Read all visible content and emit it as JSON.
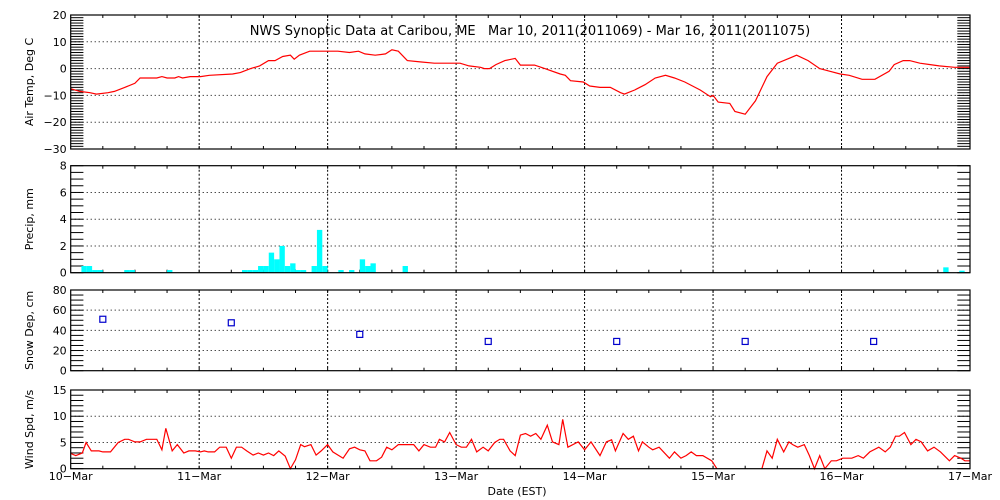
{
  "chart_data": {
    "title": "NWS Synoptic Data at Caribou, ME   Mar 10, 2011(2011069) - Mar 16, 2011(2011075)",
    "xlabel": "Date (EST)",
    "x_units": "days since 10-Mar 00:00 EST",
    "xlim": [
      0,
      7
    ],
    "x_tick_labels": [
      "10-Mar",
      "11-Mar",
      "12-Mar",
      "13-Mar",
      "14-Mar",
      "15-Mar",
      "16-Mar",
      "17-Mar"
    ],
    "grid": true,
    "colors": {
      "temp": "#ff0000",
      "precip": "#00ffff",
      "snow": "#0000cc",
      "wind": "#ff0000"
    },
    "panels": [
      {
        "id": "air-temp",
        "type": "line",
        "ylabel": "Air Temp, Deg C",
        "ylim": [
          -30,
          20
        ],
        "yticks": [
          -30,
          -20,
          -10,
          0,
          10,
          20
        ],
        "minor_step": 1,
        "points": [
          [
            0,
            -7.5
          ],
          [
            0.07,
            -8.5
          ],
          [
            0.15,
            -9
          ],
          [
            0.2,
            -9.5
          ],
          [
            0.29,
            -9
          ],
          [
            0.34,
            -8.5
          ],
          [
            0.42,
            -7
          ],
          [
            0.5,
            -5.5
          ],
          [
            0.54,
            -3.5
          ],
          [
            0.67,
            -3.5
          ],
          [
            0.71,
            -3
          ],
          [
            0.75,
            -3.5
          ],
          [
            0.81,
            -3.5
          ],
          [
            0.84,
            -3
          ],
          [
            0.87,
            -3.5
          ],
          [
            0.93,
            -3
          ],
          [
            1.01,
            -3
          ],
          [
            1.08,
            -2.5
          ],
          [
            1.26,
            -2
          ],
          [
            1.32,
            -1.5
          ],
          [
            1.4,
            0
          ],
          [
            1.47,
            1
          ],
          [
            1.54,
            3
          ],
          [
            1.59,
            3
          ],
          [
            1.65,
            4.5
          ],
          [
            1.71,
            5
          ],
          [
            1.74,
            3.5
          ],
          [
            1.78,
            5
          ],
          [
            1.86,
            6.5
          ],
          [
            2.08,
            6.5
          ],
          [
            2.17,
            6
          ],
          [
            2.24,
            6.5
          ],
          [
            2.29,
            5.5
          ],
          [
            2.37,
            5
          ],
          [
            2.45,
            5.5
          ],
          [
            2.5,
            7
          ],
          [
            2.55,
            6.5
          ],
          [
            2.62,
            3
          ],
          [
            2.72,
            2.5
          ],
          [
            2.83,
            2
          ],
          [
            3.03,
            2
          ],
          [
            3.1,
            1
          ],
          [
            3.19,
            0.5
          ],
          [
            3.22,
            0
          ],
          [
            3.26,
            0
          ],
          [
            3.31,
            1.5
          ],
          [
            3.38,
            3
          ],
          [
            3.46,
            3.8
          ],
          [
            3.5,
            1.3
          ],
          [
            3.61,
            1.3
          ],
          [
            3.69,
            0
          ],
          [
            3.81,
            -2
          ],
          [
            3.85,
            -2.5
          ],
          [
            3.89,
            -4.5
          ],
          [
            3.99,
            -5
          ],
          [
            4.04,
            -6.5
          ],
          [
            4.12,
            -7
          ],
          [
            4.2,
            -7
          ],
          [
            4.28,
            -9
          ],
          [
            4.31,
            -9.5
          ],
          [
            4.39,
            -8
          ],
          [
            4.47,
            -6
          ],
          [
            4.55,
            -3.5
          ],
          [
            4.63,
            -2.5
          ],
          [
            4.7,
            -3.5
          ],
          [
            4.78,
            -5
          ],
          [
            4.9,
            -8
          ],
          [
            4.98,
            -10.5
          ],
          [
            5.0,
            -10
          ],
          [
            5.04,
            -12.5
          ],
          [
            5.13,
            -13
          ],
          [
            5.17,
            -16
          ],
          [
            5.25,
            -17
          ],
          [
            5.33,
            -12
          ],
          [
            5.42,
            -3
          ],
          [
            5.5,
            2
          ],
          [
            5.6,
            4
          ],
          [
            5.65,
            5
          ],
          [
            5.74,
            3
          ],
          [
            5.83,
            0
          ],
          [
            5.91,
            -1
          ],
          [
            5.99,
            -2
          ],
          [
            6.06,
            -2.5
          ],
          [
            6.16,
            -4
          ],
          [
            6.26,
            -4
          ],
          [
            6.37,
            -1
          ],
          [
            6.41,
            1.5
          ],
          [
            6.48,
            3
          ],
          [
            6.53,
            3
          ],
          [
            6.61,
            2
          ],
          [
            6.69,
            1.5
          ],
          [
            6.76,
            1
          ],
          [
            6.88,
            0.5
          ],
          [
            7.0,
            0.5
          ]
        ]
      },
      {
        "id": "precip",
        "type": "bar",
        "ylabel": "Precip, mm",
        "ylim": [
          0,
          8
        ],
        "yticks": [
          0,
          2,
          4,
          6,
          8
        ],
        "minor_step": 0.5,
        "bin_hours": 1,
        "bars_hour_value": [
          [
            2,
            0.5
          ],
          [
            3,
            0.5
          ],
          [
            4,
            0.2
          ],
          [
            5,
            0.2
          ],
          [
            10,
            0.2
          ],
          [
            11,
            0.2
          ],
          [
            18,
            0.2
          ],
          [
            32,
            0.2
          ],
          [
            33,
            0.2
          ],
          [
            34,
            0.2
          ],
          [
            35,
            0.5
          ],
          [
            36,
            0.5
          ],
          [
            37,
            1.5
          ],
          [
            38,
            1.0
          ],
          [
            39,
            2.0
          ],
          [
            40,
            0.5
          ],
          [
            41,
            0.7
          ],
          [
            42,
            0.2
          ],
          [
            43,
            0.2
          ],
          [
            45,
            0.5
          ],
          [
            46,
            3.2
          ],
          [
            47,
            0.5
          ],
          [
            50,
            0.2
          ],
          [
            52,
            0.2
          ],
          [
            54,
            1.0
          ],
          [
            55,
            0.5
          ],
          [
            56,
            0.7
          ],
          [
            62,
            0.5
          ],
          [
            163,
            0.4
          ],
          [
            166,
            0.15
          ]
        ]
      },
      {
        "id": "snow-depth",
        "type": "scatter",
        "ylabel": "Snow Dep, cm",
        "ylim": [
          0,
          80
        ],
        "yticks": [
          0,
          20,
          40,
          60,
          80
        ],
        "minor_step": 5,
        "points": [
          [
            0.25,
            51
          ],
          [
            1.25,
            47.5
          ],
          [
            2.25,
            36
          ],
          [
            3.25,
            29
          ],
          [
            4.25,
            29
          ],
          [
            5.25,
            29
          ],
          [
            6.25,
            29
          ]
        ]
      },
      {
        "id": "wind-speed",
        "type": "line",
        "ylabel": "Wind Spd, m/s",
        "ylim": [
          0,
          15
        ],
        "yticks": [
          0,
          5,
          10,
          15
        ],
        "minor_step": 1,
        "points": [
          [
            0,
            2.9
          ],
          [
            0.04,
            2.5
          ],
          [
            0.09,
            3
          ],
          [
            0.12,
            5
          ],
          [
            0.16,
            3.4
          ],
          [
            0.22,
            3.4
          ],
          [
            0.25,
            3.2
          ],
          [
            0.31,
            3.2
          ],
          [
            0.37,
            5
          ],
          [
            0.42,
            5.6
          ],
          [
            0.45,
            5.6
          ],
          [
            0.5,
            5.1
          ],
          [
            0.54,
            5.1
          ],
          [
            0.59,
            5.6
          ],
          [
            0.67,
            5.6
          ],
          [
            0.71,
            3.6
          ],
          [
            0.74,
            7.7
          ],
          [
            0.79,
            3.4
          ],
          [
            0.83,
            4.6
          ],
          [
            0.88,
            3
          ],
          [
            0.92,
            3.4
          ],
          [
            0.97,
            3.4
          ],
          [
            1.01,
            3.2
          ],
          [
            1.04,
            3.4
          ],
          [
            1.07,
            3.2
          ],
          [
            1.12,
            3.2
          ],
          [
            1.16,
            4.1
          ],
          [
            1.21,
            4.1
          ],
          [
            1.25,
            2
          ],
          [
            1.29,
            4.1
          ],
          [
            1.33,
            4.1
          ],
          [
            1.37,
            3.4
          ],
          [
            1.42,
            2.6
          ],
          [
            1.46,
            3
          ],
          [
            1.5,
            2.6
          ],
          [
            1.54,
            3
          ],
          [
            1.58,
            2.5
          ],
          [
            1.62,
            3.4
          ],
          [
            1.67,
            2.4
          ],
          [
            1.71,
            0
          ],
          [
            1.75,
            1.7
          ],
          [
            1.79,
            4.6
          ],
          [
            1.82,
            4.2
          ],
          [
            1.87,
            4.6
          ],
          [
            1.91,
            2.6
          ],
          [
            1.95,
            3.4
          ],
          [
            2.0,
            4.6
          ],
          [
            2.04,
            3.2
          ],
          [
            2.12,
            2
          ],
          [
            2.17,
            3.8
          ],
          [
            2.21,
            4.1
          ],
          [
            2.25,
            3.6
          ],
          [
            2.29,
            3.4
          ],
          [
            2.33,
            1.5
          ],
          [
            2.38,
            1.5
          ],
          [
            2.42,
            2.2
          ],
          [
            2.46,
            4.1
          ],
          [
            2.5,
            3.6
          ],
          [
            2.55,
            4.6
          ],
          [
            2.67,
            4.6
          ],
          [
            2.71,
            3.4
          ],
          [
            2.75,
            4.6
          ],
          [
            2.8,
            4.1
          ],
          [
            2.84,
            4.1
          ],
          [
            2.87,
            5.6
          ],
          [
            2.91,
            5.1
          ],
          [
            2.95,
            6.9
          ],
          [
            3.0,
            4.6
          ],
          [
            3.04,
            4.1
          ],
          [
            3.08,
            4.1
          ],
          [
            3.12,
            5.6
          ],
          [
            3.16,
            3.2
          ],
          [
            3.21,
            4.1
          ],
          [
            3.25,
            3.4
          ],
          [
            3.3,
            5
          ],
          [
            3.34,
            5.6
          ],
          [
            3.37,
            5.6
          ],
          [
            3.42,
            3.4
          ],
          [
            3.46,
            2.5
          ],
          [
            3.5,
            6.4
          ],
          [
            3.54,
            6.7
          ],
          [
            3.58,
            6.2
          ],
          [
            3.62,
            6.7
          ],
          [
            3.66,
            5.6
          ],
          [
            3.71,
            8.3
          ],
          [
            3.75,
            5.1
          ],
          [
            3.8,
            4.6
          ],
          [
            3.83,
            9.4
          ],
          [
            3.87,
            4.1
          ],
          [
            3.95,
            5.1
          ],
          [
            4.0,
            3.6
          ],
          [
            4.05,
            5.1
          ],
          [
            4.12,
            2.5
          ],
          [
            4.17,
            5.1
          ],
          [
            4.21,
            5.5
          ],
          [
            4.24,
            3.4
          ],
          [
            4.3,
            6.7
          ],
          [
            4.34,
            5.6
          ],
          [
            4.38,
            6.2
          ],
          [
            4.42,
            3.4
          ],
          [
            4.45,
            5.1
          ],
          [
            4.5,
            4.1
          ],
          [
            4.53,
            3.6
          ],
          [
            4.58,
            4.1
          ],
          [
            4.66,
            2
          ],
          [
            4.7,
            3.2
          ],
          [
            4.75,
            2
          ],
          [
            4.79,
            2.5
          ],
          [
            4.83,
            3.2
          ],
          [
            4.87,
            2.5
          ],
          [
            4.92,
            2.5
          ],
          [
            4.99,
            1.5
          ],
          [
            5.03,
            0
          ],
          null,
          [
            5.38,
            0
          ],
          [
            5.42,
            3.4
          ],
          [
            5.46,
            2
          ],
          [
            5.5,
            5.6
          ],
          [
            5.55,
            3.2
          ],
          [
            5.59,
            5.1
          ],
          [
            5.62,
            4.6
          ],
          [
            5.66,
            4.1
          ],
          [
            5.71,
            4.6
          ],
          [
            5.75,
            2.5
          ],
          [
            5.79,
            0
          ],
          [
            5.83,
            2.5
          ],
          [
            5.87,
            0
          ],
          [
            5.92,
            1.5
          ],
          [
            5.96,
            1.5
          ],
          [
            6.01,
            2
          ],
          [
            6.08,
            2
          ],
          [
            6.13,
            2.5
          ],
          [
            6.17,
            2
          ],
          [
            6.22,
            3.2
          ],
          [
            6.29,
            4.1
          ],
          [
            6.34,
            3.2
          ],
          [
            6.38,
            4.1
          ],
          [
            6.42,
            6.2
          ],
          [
            6.45,
            6.2
          ],
          [
            6.49,
            6.9
          ],
          [
            6.54,
            4.6
          ],
          [
            6.58,
            5.6
          ],
          [
            6.62,
            5.1
          ],
          [
            6.67,
            3.4
          ],
          [
            6.72,
            4.1
          ],
          [
            6.77,
            3.2
          ],
          [
            6.84,
            1.5
          ],
          [
            6.88,
            2.5
          ],
          [
            6.93,
            2
          ],
          [
            6.96,
            1.5
          ],
          [
            7.0,
            1.5
          ]
        ]
      }
    ]
  }
}
